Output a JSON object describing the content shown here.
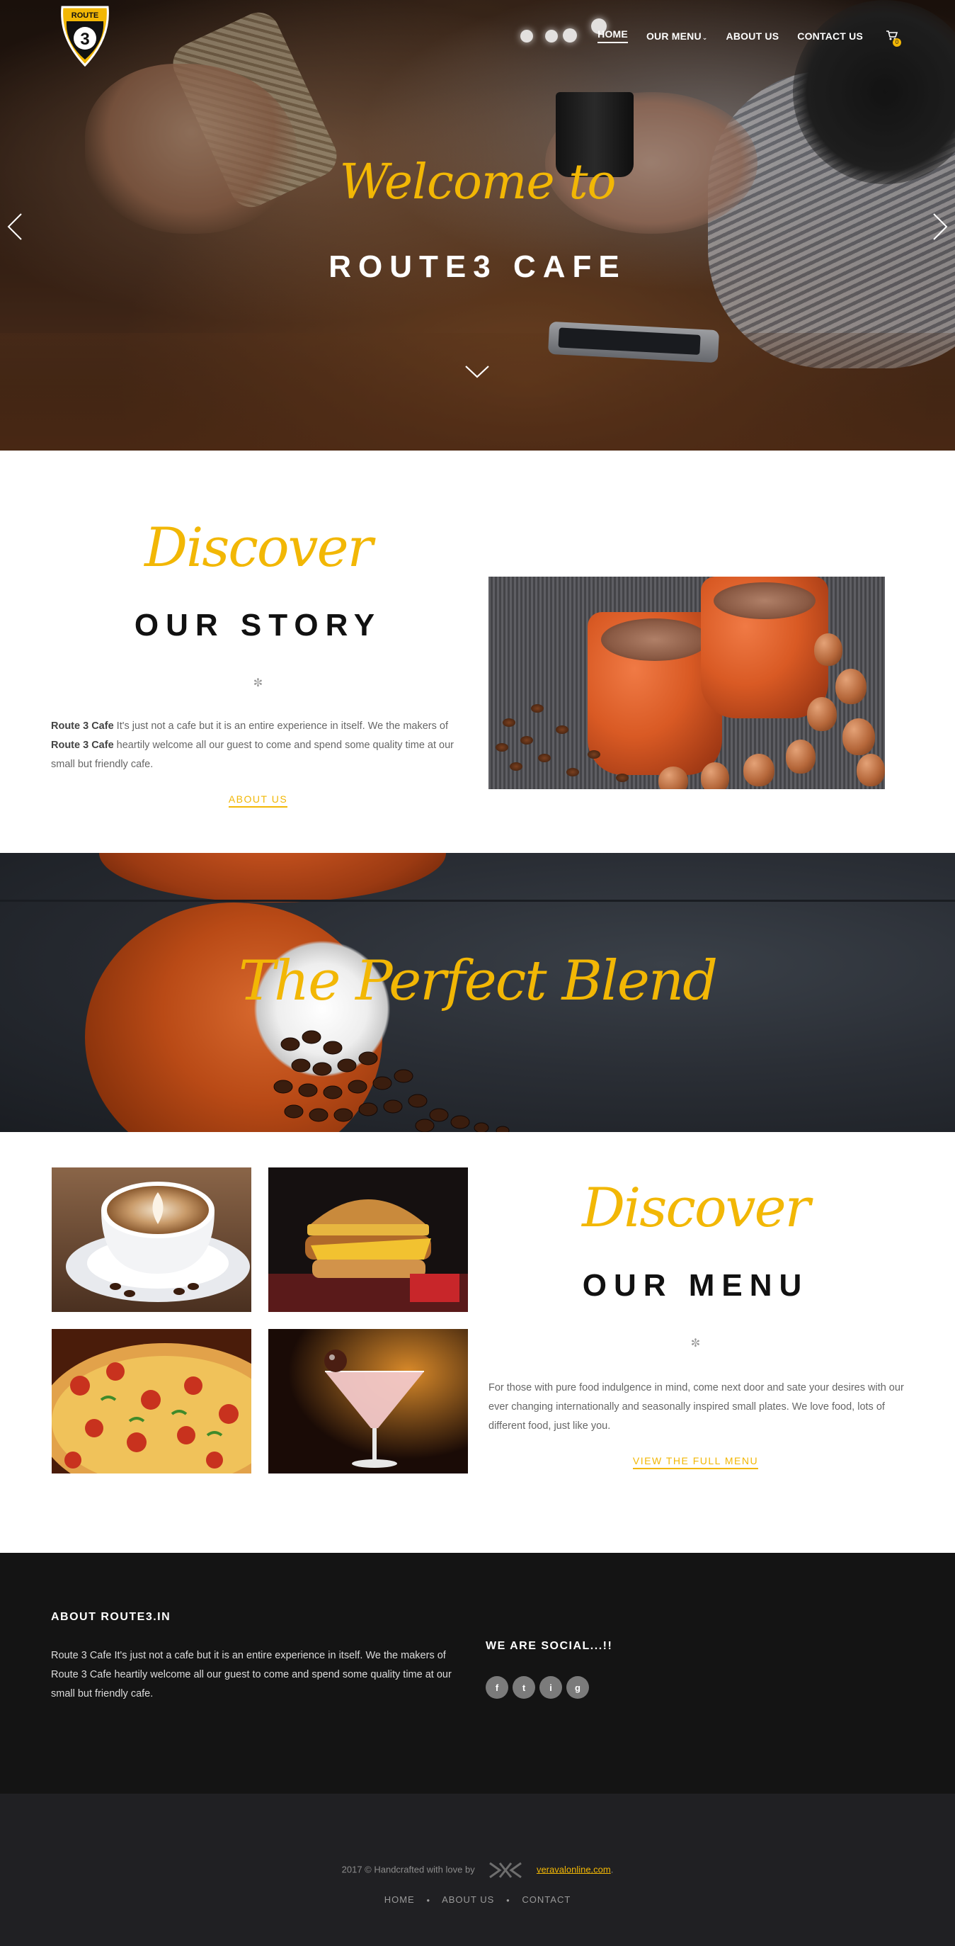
{
  "brand": {
    "logo_top": "ROUTE",
    "logo_number": "3",
    "accent": "#f2b705"
  },
  "nav": {
    "items": [
      {
        "label": "HOME",
        "active": true
      },
      {
        "label": "OUR MENU",
        "dropdown": true
      },
      {
        "label": "ABOUT US"
      },
      {
        "label": "CONTACT US"
      }
    ],
    "cart_count": "0"
  },
  "hero": {
    "script": "Welcome to",
    "title": "ROUTE3 CAFE"
  },
  "story": {
    "script": "Discover",
    "title": "OUR STORY",
    "divider": "✼",
    "text_brand_1": "Route 3 Cafe",
    "text_part_1": " It's just not a cafe but it is an entire experience in itself. We the makers of ",
    "text_brand_2": "Route 3 Cafe",
    "text_part_2": " heartily welcome all our guest to come and spend some quality time at our small but friendly cafe.",
    "link": "ABOUT US"
  },
  "blend": {
    "title": "The Perfect Blend"
  },
  "menu": {
    "script": "Discover",
    "title": "OUR MENU",
    "divider": "✼",
    "text": "For those with pure food indulgence in mind, come next door and sate your desires with our ever changing internationally and seasonally inspired small plates.  We love food, lots of different food, just like you.",
    "link": "VIEW THE FULL MENU",
    "thumbnails": [
      "coffee-latte",
      "burger",
      "pizza",
      "cocktail"
    ]
  },
  "footer": {
    "about_heading": "ABOUT ROUTE3.IN",
    "about_text": "Route 3 Cafe It's just not a cafe but it is an entire experience in itself. We the makers of Route 3 Cafe heartily welcome all our guest to come and spend some quality time at our small but friendly cafe.",
    "social_heading": "WE ARE SOCIAL...!!",
    "social_icons": [
      "f",
      "t",
      "i",
      "g"
    ],
    "credit_text": "2017 © Handcrafted with love by",
    "credit_site": "veravalonline.com",
    "credit_period": ".",
    "links": [
      "HOME",
      "ABOUT US",
      "CONTACT"
    ]
  }
}
